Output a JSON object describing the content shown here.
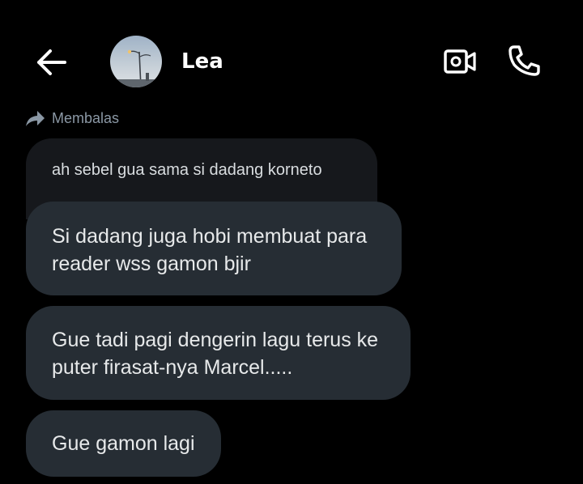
{
  "header": {
    "contact_name": "Lea",
    "back_icon": "arrow-left-icon",
    "video_icon": "video-call-icon",
    "call_icon": "phone-icon",
    "avatar": "contact-avatar"
  },
  "reply": {
    "icon": "reply-arrow-icon",
    "label": "Membalas",
    "quoted_text": "ah sebel gua sama si dadang korneto"
  },
  "messages": [
    {
      "lines": [
        "Si dadang juga hobi membuat para",
        "reader wss gamon bjir"
      ]
    },
    {
      "lines": [
        "Gue tadi pagi dengerin lagu terus ke",
        "puter firasat-nya Marcel....."
      ]
    },
    {
      "lines": [
        "Gue gamon lagi"
      ]
    }
  ],
  "colors": {
    "background": "#000000",
    "bubble": "#262d34",
    "quoted_bubble": "#16181c",
    "secondary_text": "#8b98a5",
    "primary_text": "#e7e9ea"
  }
}
